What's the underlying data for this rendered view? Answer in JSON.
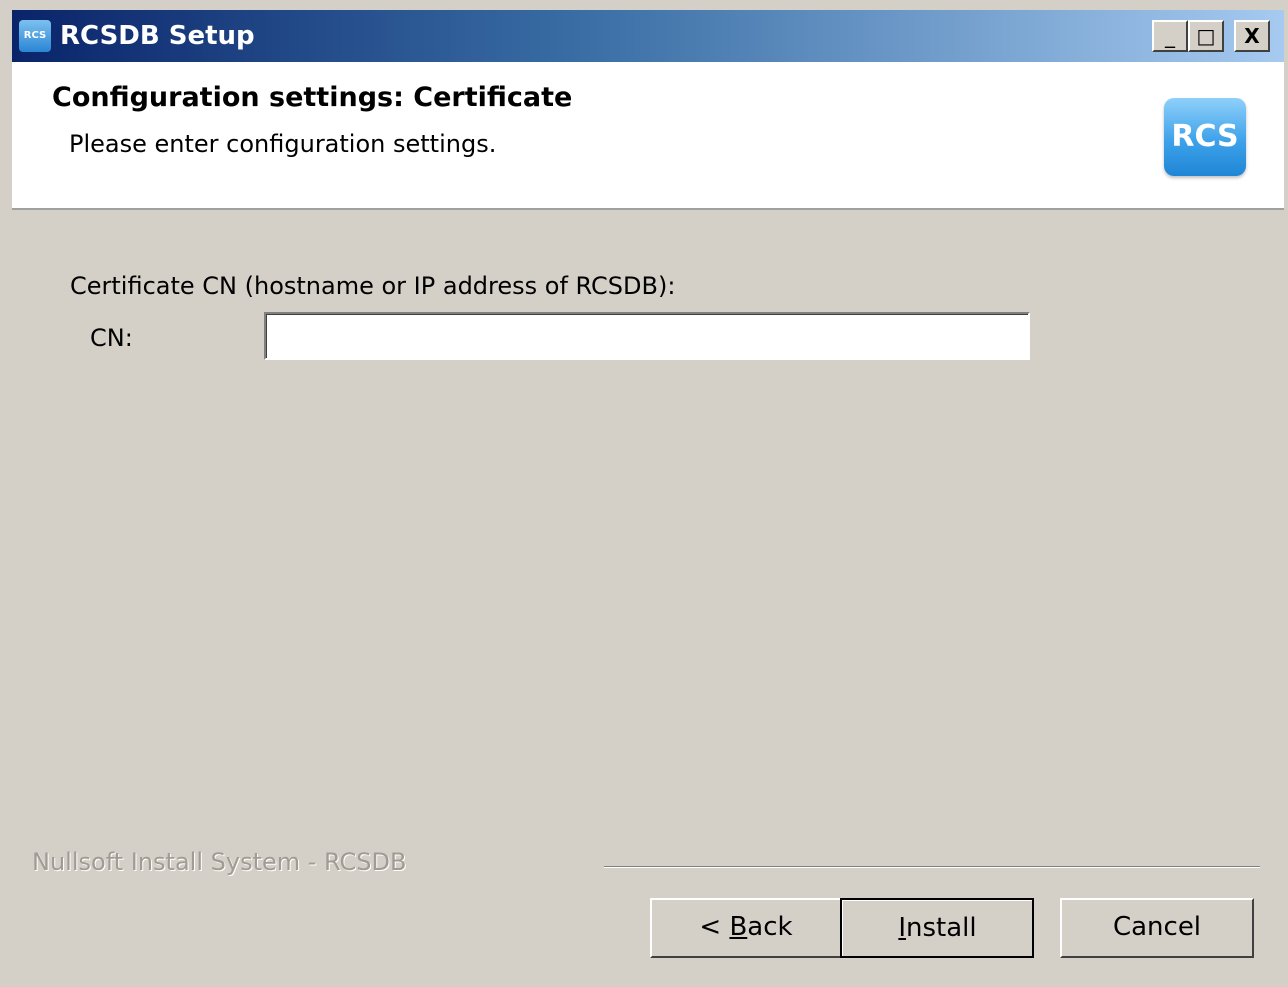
{
  "window": {
    "title": "RCSDB Setup",
    "title_icon_text": "RCS",
    "controls": {
      "minimize": "_",
      "maximize": "□",
      "close": "X"
    }
  },
  "header": {
    "title": "Configuration settings: Certificate",
    "subtitle": "Please enter configuration settings.",
    "logo_text": "RCS"
  },
  "form": {
    "cert_label": "Certificate CN (hostname or IP address of RCSDB):",
    "cn_label": "CN:",
    "cn_value": ""
  },
  "footer": {
    "brand": "Nullsoft Install System - RCSDB",
    "buttons": {
      "back_prefix": "< ",
      "back_accel": "B",
      "back_rest": "ack",
      "install_accel": "I",
      "install_rest": "nstall",
      "cancel": "Cancel"
    }
  },
  "colors": {
    "title_gradient_start": "#0a246a",
    "title_gradient_end": "#a6caf0",
    "dialog_bg": "#d4d0c8",
    "brand_text": "#a09c94",
    "logo_blue": "#3ea2ea"
  }
}
